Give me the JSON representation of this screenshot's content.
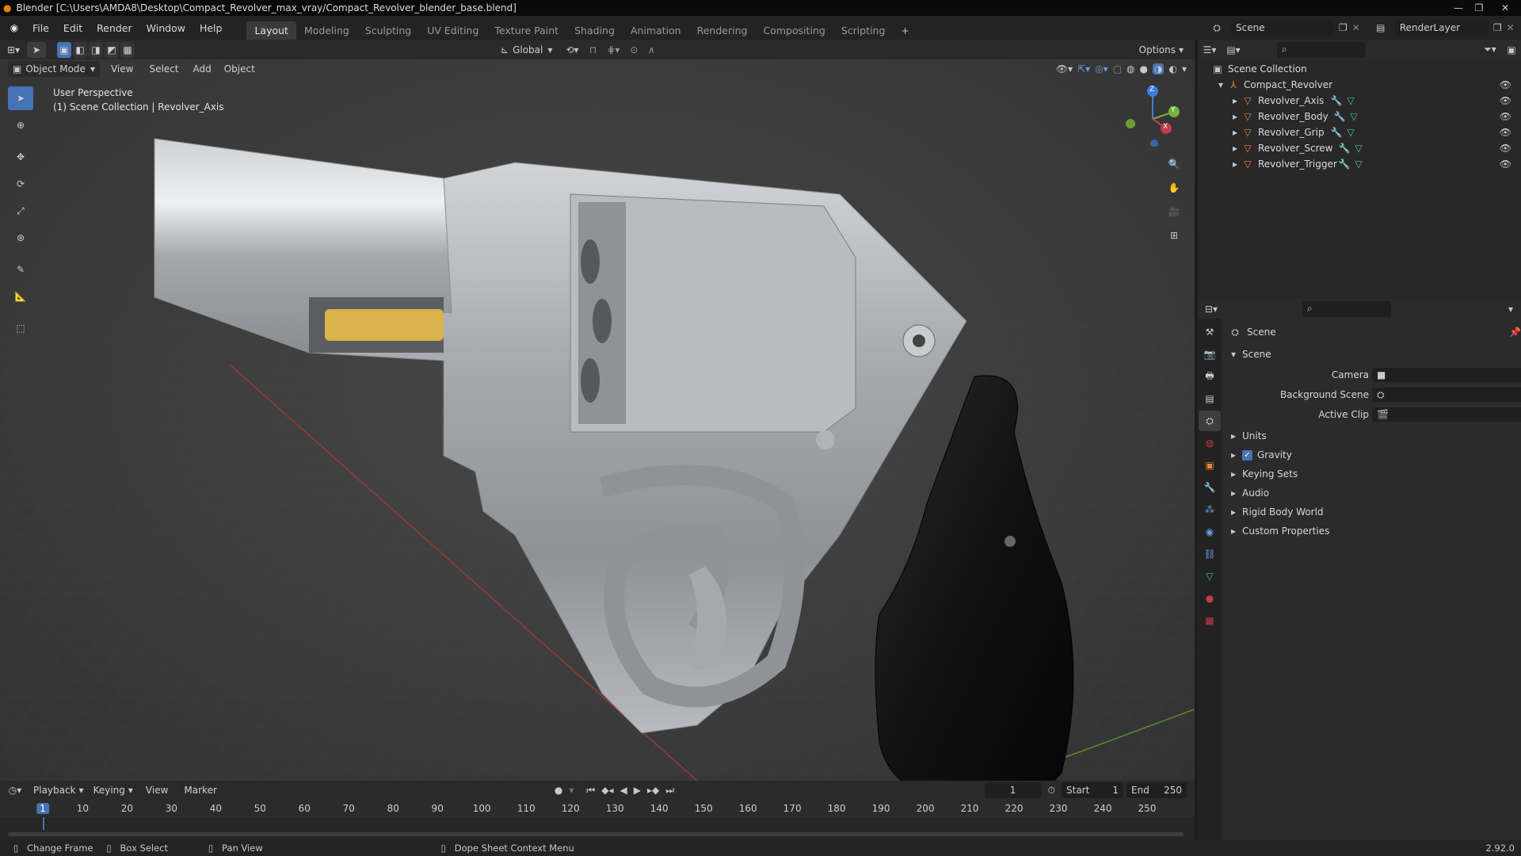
{
  "window": {
    "title": "Blender [C:\\Users\\AMDA8\\Desktop\\Compact_Revolver_max_vray/Compact_Revolver_blender_base.blend]"
  },
  "menu": [
    "File",
    "Edit",
    "Render",
    "Window",
    "Help"
  ],
  "workspaces": [
    "Layout",
    "Modeling",
    "Sculpting",
    "UV Editing",
    "Texture Paint",
    "Shading",
    "Animation",
    "Rendering",
    "Compositing",
    "Scripting"
  ],
  "active_workspace": "Layout",
  "scene_selector": {
    "scene": "Scene",
    "view_layer": "RenderLayer"
  },
  "viewport_header": {
    "transform_orientation": "Global",
    "options_label": "Options",
    "mode": "Object Mode",
    "menus": [
      "View",
      "Select",
      "Add",
      "Object"
    ]
  },
  "viewport": {
    "perspective_label": "User Perspective",
    "collection_label": "(1) Scene Collection | Revolver_Axis",
    "gizmo": {
      "x": "X",
      "y": "Y",
      "z": "Z"
    }
  },
  "outliner": {
    "root": "Scene Collection",
    "collection": "Compact_Revolver",
    "objects": [
      "Revolver_Axis",
      "Revolver_Body",
      "Revolver_Grip",
      "Revolver_Screw",
      "Revolver_Trigger"
    ]
  },
  "properties": {
    "breadcrumb": "Scene",
    "panel_title": "Scene",
    "fields": [
      {
        "label": "Camera",
        "value": ""
      },
      {
        "label": "Background Scene",
        "value": ""
      },
      {
        "label": "Active Clip",
        "value": ""
      }
    ],
    "sections": [
      "Units",
      "Gravity",
      "Keying Sets",
      "Audio",
      "Rigid Body World",
      "Custom Properties"
    ],
    "gravity_checked": true
  },
  "timeline": {
    "menus": [
      "Playback",
      "Keying",
      "View",
      "Marker"
    ],
    "current_frame": "1",
    "start_label": "Start",
    "start": "1",
    "end_label": "End",
    "end": "250",
    "ruler": [
      "1",
      "10",
      "20",
      "30",
      "40",
      "50",
      "60",
      "70",
      "80",
      "90",
      "100",
      "110",
      "120",
      "130",
      "140",
      "150",
      "160",
      "170",
      "180",
      "190",
      "200",
      "210",
      "220",
      "230",
      "240",
      "250"
    ]
  },
  "statusbar": {
    "items": [
      "Change Frame",
      "Box Select",
      "Pan View",
      "Dope Sheet Context Menu"
    ],
    "version": "2.92.0"
  },
  "colors": {
    "accent": "#4772b3",
    "x_axis": "#c43a4a",
    "y_axis": "#7ab33a",
    "z_axis": "#3d7be0",
    "object_icon": "#e8853a",
    "modifier_icon": "#6b9be0",
    "mesh_icon": "#3fc99a"
  }
}
